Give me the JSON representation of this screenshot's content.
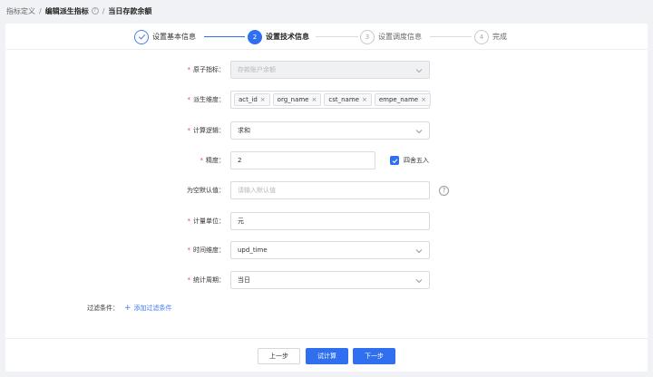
{
  "breadcrumb": {
    "items": [
      "指标定义",
      "编辑派生指标",
      "当日存款余额"
    ],
    "separator": "/",
    "help_icon": "?"
  },
  "steps": [
    {
      "number": "1",
      "label": "设置基本信息",
      "state": "done"
    },
    {
      "number": "2",
      "label": "设置技术信息",
      "state": "active"
    },
    {
      "number": "3",
      "label": "设置调度信息",
      "state": "wait"
    },
    {
      "number": "4",
      "label": "完成",
      "state": "wait"
    }
  ],
  "form": {
    "atomic_indicator": {
      "label": "原子指标：",
      "value": "存款账户余额",
      "required": true,
      "disabled": true
    },
    "dimensions": {
      "label": "派生维度：",
      "required": true,
      "tags": [
        "act_id",
        "org_name",
        "cst_name",
        "empe_name"
      ],
      "remove_glyph": "×"
    },
    "calc_logic": {
      "label": "计算逻辑：",
      "value": "求和",
      "required": true
    },
    "precision": {
      "label": "精度：",
      "value": "2",
      "required": true,
      "rounding_label": "四舍五入",
      "rounding_checked": true
    },
    "null_default": {
      "label": "为空默认值：",
      "placeholder": "请输入默认值",
      "required": false
    },
    "unit": {
      "label": "计量单位：",
      "value": "元",
      "required": true
    },
    "time_dimension": {
      "label": "时间维度：",
      "value": "upd_time",
      "required": true
    },
    "stat_period": {
      "label": "统计周期：",
      "value": "当日",
      "required": true
    }
  },
  "required_mark": "*",
  "filter": {
    "label": "过滤条件：",
    "add_label": "添加过滤条件",
    "add_icon": "+"
  },
  "footer": {
    "prev": "上一步",
    "trial": "试计算",
    "next": "下一步"
  },
  "colors": {
    "primary": "#2f6ff0",
    "required": "#e24c4c",
    "background": "#f0f2f5"
  }
}
